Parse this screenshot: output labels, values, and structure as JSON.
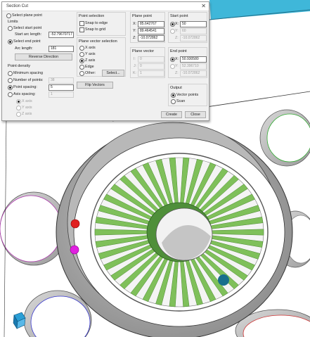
{
  "dialog": {
    "title": "Section Cut",
    "close_glyph": "✕",
    "select_plane_point": "Select plane point",
    "limits": {
      "title": "Limits",
      "select_start_point": "Select start point",
      "start_arc_length_label": "Start arc length:",
      "start_arc_length_value": "-52.79670717",
      "select_end_point": "Select end point",
      "arc_length_label": "Arc length:",
      "arc_length_value": "181",
      "reverse_direction": "Reverse Direction"
    },
    "point_density": {
      "title": "Point density",
      "minimum_spacing": "Minimum spacing",
      "number_of_points_label": "Number of points:",
      "number_of_points_value": "38",
      "point_spacing_label": "Point spacing:",
      "point_spacing_value": "5",
      "axis_spacing_label": "Axis spacing:",
      "axis_spacing_value": "1",
      "x_axis": "X axis",
      "y_axis": "Y axis",
      "z_axis": "Z axis"
    },
    "point_selection": {
      "title": "Point selection",
      "snap_to_edge": "Snap to edge",
      "snap_to_grid": "Snap to grid"
    },
    "plane_vector_selection": {
      "title": "Plane vector selection",
      "x_axis": "X axis",
      "y_axis": "Y axis",
      "z_axis": "Z axis",
      "edge": "Edge",
      "other": "Other:",
      "select_button": "Select..."
    },
    "flip_vectors": "Flip Vectors",
    "plane_point": {
      "title": "Plane point",
      "x_label": "X:",
      "x_value": "85.642767",
      "y_label": "Y:",
      "y_value": "89.464541",
      "z_label": "Z:",
      "z_value": "-10.072862"
    },
    "plane_vector": {
      "title": "Plane vector",
      "i_label": "I:",
      "i_value": "0",
      "j_label": "J:",
      "j_value": "0",
      "k_label": "K:",
      "k_value": "1"
    },
    "start_point": {
      "title": "Start point",
      "x_label": "X:",
      "x_value": "50",
      "y_label": "Y:",
      "y_value": "60",
      "z_label": "Z:",
      "z_value": "-10.072862"
    },
    "end_point": {
      "title": "End point",
      "x_label": "X:",
      "x_value": "50.930580",
      "y_label": "Y:",
      "y_value": "52.396710",
      "z_label": "Z:",
      "z_value": "-10.072862"
    },
    "output": {
      "title": "Output",
      "vector_points": "Vector points",
      "scan": "Scan"
    },
    "create_button": "Create",
    "close_button": "Close"
  },
  "colors": {
    "fin_green": "#7fc05a",
    "fin_dark": "#4e8a34",
    "housing_gray": "#a9a9a9",
    "point_red": "#e02020",
    "point_magenta": "#e020e0",
    "accent_cyan": "#1aa0c8"
  }
}
